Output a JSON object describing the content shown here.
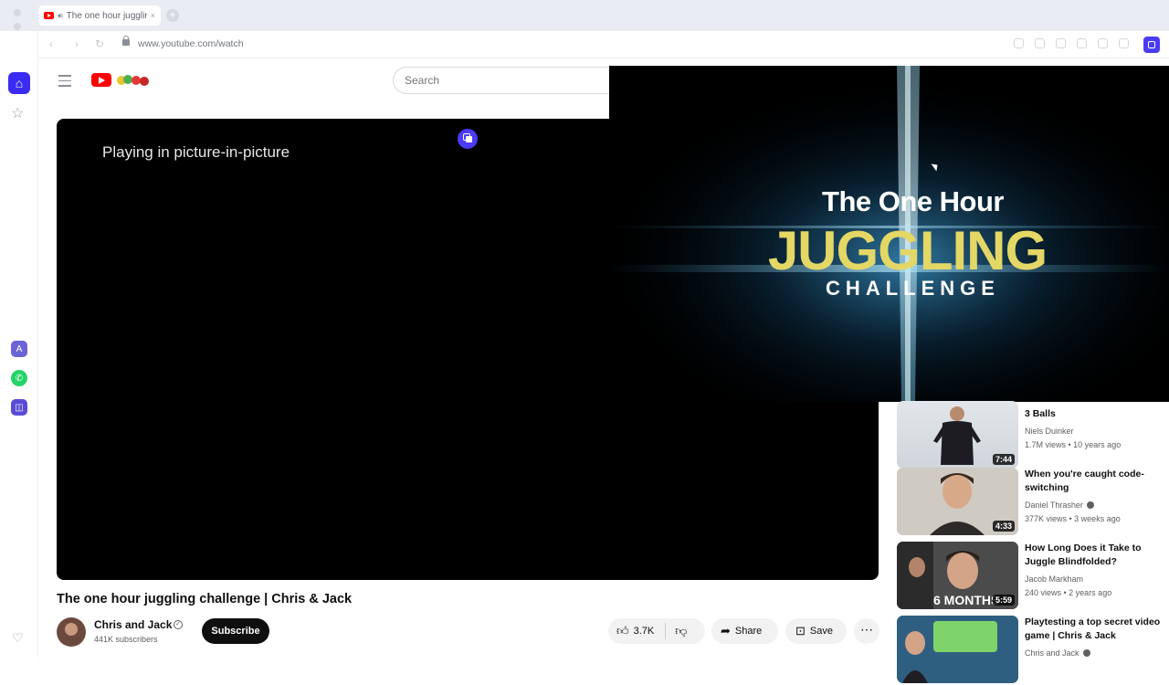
{
  "browser": {
    "tab": {
      "title": "The one hour juggling challenge | Chris & Jack",
      "close": "×"
    },
    "new_tab": "+",
    "back": "‹",
    "forward": "›",
    "reload": "↻",
    "url": "www.youtube.com/watch",
    "accent": "#4a3bf5"
  },
  "app_sidebar": {
    "home_icon": "⌂",
    "star_icon": "☆",
    "apps": [
      {
        "name": "pinned-app-1",
        "color": "#6c63d6",
        "glyph": "A"
      },
      {
        "name": "whatsapp-app",
        "color": "#25d366",
        "glyph": "✆"
      },
      {
        "name": "pinned-app-3",
        "color": "#5a4bd6",
        "glyph": "◫"
      }
    ],
    "heart_icon": "♡"
  },
  "youtube": {
    "search_placeholder": "Search",
    "logo_color": "#ff0000"
  },
  "player": {
    "status_text": "Playing in picture-in-picture"
  },
  "pip_window": {
    "line1": "The One Hour",
    "line2": "JUGGLING",
    "line3": "CHALLENGE",
    "line2_color": "#e4d766"
  },
  "video": {
    "title": "The one hour juggling challenge | Chris & Jack",
    "channel": "Chris and Jack",
    "subscribers": "441K subscribers",
    "subscribe_label": "Subscribe",
    "likes": "3.7K",
    "share_label": "Share",
    "save_label": "Save",
    "more": "⋯"
  },
  "recommendations": [
    {
      "title": "3 Balls",
      "channel": "Niels Duinker",
      "meta": "1.7M views • 10 years ago",
      "duration": "7:44",
      "verified": false
    },
    {
      "title": "When you're caught code-switching",
      "channel": "Daniel Thrasher",
      "meta": "377K views • 3 weeks ago",
      "duration": "4:33",
      "verified": true
    },
    {
      "title": "How Long Does it Take to Juggle Blindfolded?",
      "channel": "Jacob Markham",
      "meta": "240 views • 2 years ago",
      "duration": "5:59",
      "overlay": "6 MONTHS",
      "verified": false
    },
    {
      "title": "Playtesting a top secret video game | Chris & Jack",
      "channel": "Chris and Jack",
      "meta": "",
      "duration": "",
      "verified": true
    }
  ]
}
